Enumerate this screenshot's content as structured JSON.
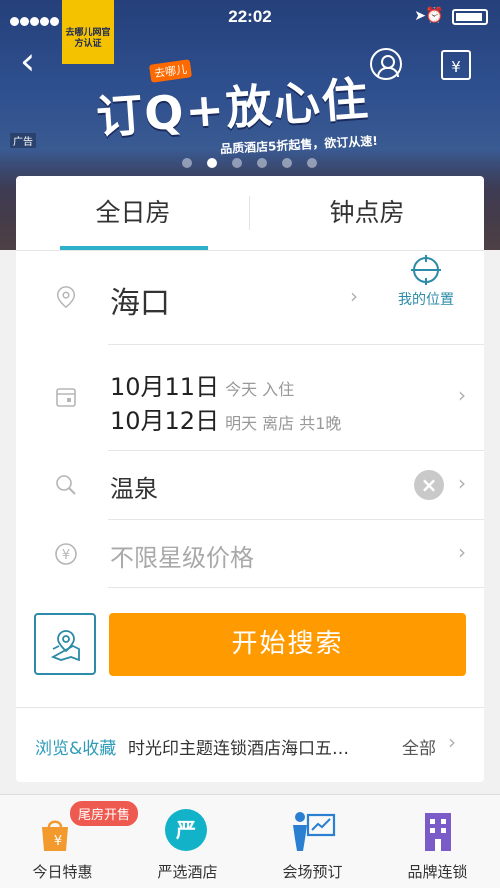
{
  "status_bar": {
    "time": "22:02"
  },
  "banner": {
    "badge_text": "去哪儿网官方认证",
    "promo_tag": "去哪儿",
    "promo_title": "订Q+放心住",
    "promo_sub": "品质酒店5折起售，欲订从速!",
    "ad_label": "广告",
    "dots_count": 6,
    "active_dot": 1
  },
  "tabs": {
    "all_day": "全日房",
    "hourly": "钟点房",
    "selected": "all_day"
  },
  "location": {
    "city": "海口",
    "my_location": "我的位置"
  },
  "dates": {
    "checkin": "10月11日",
    "checkin_note": "今天 入住",
    "checkout": "10月12日",
    "checkout_note": "明天 离店 共1晚"
  },
  "keyword": {
    "value": "温泉"
  },
  "price": {
    "placeholder": "不限星级价格"
  },
  "search": {
    "label": "开始搜索"
  },
  "browse": {
    "label": "浏览&收藏",
    "hotel": "时光印主题连锁酒店海口五…",
    "all": "全部"
  },
  "tabbar": {
    "items": [
      {
        "label": "今日特惠",
        "tag": "尾房开售"
      },
      {
        "label": "严选酒店",
        "icon_text": "严"
      },
      {
        "label": "会场预订"
      },
      {
        "label": "品牌连锁"
      }
    ]
  },
  "colors": {
    "accent": "#2bb1c9",
    "search": "#ff9a00",
    "tag": "#ef5a50"
  }
}
